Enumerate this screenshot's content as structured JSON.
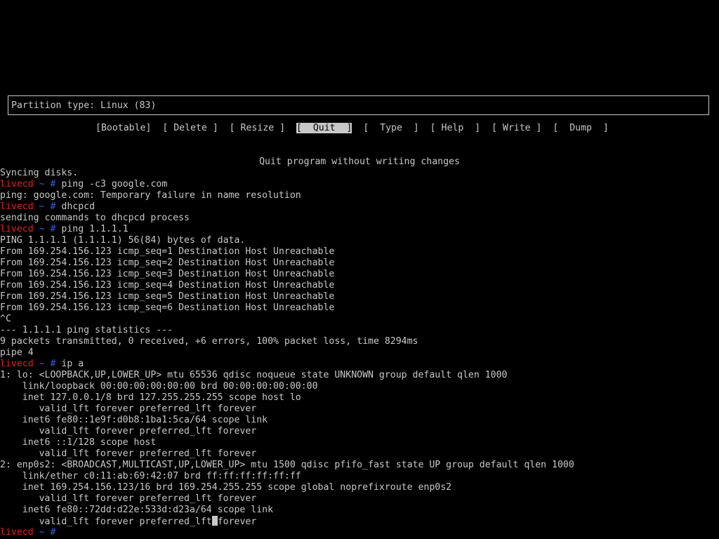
{
  "cfdisk": {
    "partition_type": "Partition type: Linux (83)",
    "menu": [
      {
        "open": "[",
        "label": "Bootable",
        "close": "]",
        "pad_left": "",
        "pad_right": "",
        "selected": false
      },
      {
        "open": "[",
        "label": "Delete",
        "close": "]",
        "pad_left": " ",
        "pad_right": " ",
        "selected": false
      },
      {
        "open": "[",
        "label": "Resize",
        "close": "]",
        "pad_left": " ",
        "pad_right": " ",
        "selected": false
      },
      {
        "open": "[",
        "label": "Quit",
        "close": "]",
        "pad_left": "  ",
        "pad_right": "  ",
        "selected": true
      },
      {
        "open": "[",
        "label": "Type",
        "close": "]",
        "pad_left": "  ",
        "pad_right": "  ",
        "selected": false
      },
      {
        "open": "[",
        "label": "Help",
        "close": "]",
        "pad_left": " ",
        "pad_right": "  ",
        "selected": false
      },
      {
        "open": "[",
        "label": "Write",
        "close": "]",
        "pad_left": " ",
        "pad_right": " ",
        "selected": false
      },
      {
        "open": "[",
        "label": "Dump",
        "close": "]",
        "pad_left": "  ",
        "pad_right": "  ",
        "selected": false
      }
    ],
    "hint": "Quit program without writing changes"
  },
  "terminal": {
    "prompt": {
      "host": "livecd",
      "path": "~",
      "symbol": "#"
    },
    "lines": [
      {
        "type": "output",
        "text": "Syncing disks."
      },
      {
        "type": "prompt",
        "command": "ping -c3 google.com"
      },
      {
        "type": "output",
        "text": "ping: google.com: Temporary failure in name resolution"
      },
      {
        "type": "prompt",
        "command": "dhcpcd"
      },
      {
        "type": "output",
        "text": "sending commands to dhcpcd process"
      },
      {
        "type": "prompt",
        "command": "ping 1.1.1.1"
      },
      {
        "type": "output",
        "text": "PING 1.1.1.1 (1.1.1.1) 56(84) bytes of data."
      },
      {
        "type": "output",
        "text": "From 169.254.156.123 icmp_seq=1 Destination Host Unreachable"
      },
      {
        "type": "output",
        "text": "From 169.254.156.123 icmp_seq=2 Destination Host Unreachable"
      },
      {
        "type": "output",
        "text": "From 169.254.156.123 icmp_seq=3 Destination Host Unreachable"
      },
      {
        "type": "output",
        "text": "From 169.254.156.123 icmp_seq=4 Destination Host Unreachable"
      },
      {
        "type": "output",
        "text": "From 169.254.156.123 icmp_seq=5 Destination Host Unreachable"
      },
      {
        "type": "output",
        "text": "From 169.254.156.123 icmp_seq=6 Destination Host Unreachable"
      },
      {
        "type": "output",
        "text": "^C"
      },
      {
        "type": "output",
        "text": "--- 1.1.1.1 ping statistics ---"
      },
      {
        "type": "output",
        "text": "9 packets transmitted, 0 received, +6 errors, 100% packet loss, time 8294ms"
      },
      {
        "type": "output",
        "text": "pipe 4"
      },
      {
        "type": "prompt",
        "command": "ip a"
      },
      {
        "type": "output",
        "text": "1: lo: <LOOPBACK,UP,LOWER_UP> mtu 65536 qdisc noqueue state UNKNOWN group default qlen 1000"
      },
      {
        "type": "output",
        "text": "    link/loopback 00:00:00:00:00:00 brd 00:00:00:00:00:00"
      },
      {
        "type": "output",
        "text": "    inet 127.0.0.1/8 brd 127.255.255.255 scope host lo"
      },
      {
        "type": "output",
        "text": "       valid_lft forever preferred_lft forever"
      },
      {
        "type": "output",
        "text": "    inet6 fe80::1e9f:d0b8:1ba1:5ca/64 scope link"
      },
      {
        "type": "output",
        "text": "       valid_lft forever preferred_lft forever"
      },
      {
        "type": "output",
        "text": "    inet6 ::1/128 scope host"
      },
      {
        "type": "output",
        "text": "       valid_lft forever preferred_lft forever"
      },
      {
        "type": "output",
        "text": "2: enp0s2: <BROADCAST,MULTICAST,UP,LOWER_UP> mtu 1500 qdisc pfifo_fast state UP group default qlen 1000"
      },
      {
        "type": "output",
        "text": "    link/ether c0:11:ab:69:42:07 brd ff:ff:ff:ff:ff:ff"
      },
      {
        "type": "output",
        "text": "    inet 169.254.156.123/16 brd 169.254.255.255 scope global noprefixroute enp0s2"
      },
      {
        "type": "output",
        "text": "       valid_lft forever preferred_lft forever"
      },
      {
        "type": "output",
        "text": "    inet6 fe80::72dd:d22e:533d:d23a/64 scope link"
      },
      {
        "type": "cursor-output",
        "before": "       valid_lft forever preferred_lft",
        "after": "forever"
      },
      {
        "type": "prompt",
        "command": ""
      }
    ]
  },
  "colors": {
    "background": "#000000",
    "foreground": "#c8c8c8",
    "prompt_host": "#e02020",
    "prompt_path": "#3b5bd6"
  }
}
